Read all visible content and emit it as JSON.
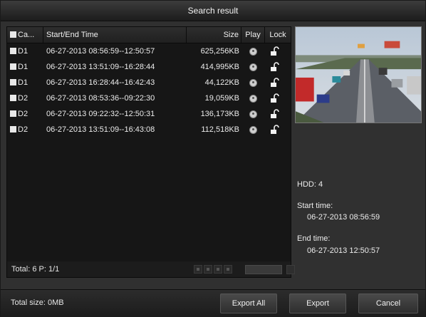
{
  "window": {
    "title": "Search result"
  },
  "table": {
    "headers": {
      "camera": "Ca...",
      "time": "Start/End Time",
      "size": "Size",
      "play": "Play",
      "lock": "Lock"
    },
    "rows": [
      {
        "camera": "D1",
        "time": "06-27-2013 08:56:59--12:50:57",
        "size": "625,256KB"
      },
      {
        "camera": "D1",
        "time": "06-27-2013 13:51:09--16:28:44",
        "size": "414,995KB"
      },
      {
        "camera": "D1",
        "time": "06-27-2013 16:28:44--16:42:43",
        "size": "44,122KB"
      },
      {
        "camera": "D2",
        "time": "06-27-2013 08:53:36--09:22:30",
        "size": "19,059KB"
      },
      {
        "camera": "D2",
        "time": "06-27-2013 09:22:32--12:50:31",
        "size": "136,173KB"
      },
      {
        "camera": "D2",
        "time": "06-27-2013 13:51:09--16:43:08",
        "size": "112,518KB"
      }
    ]
  },
  "status": {
    "total_label": "Total: 6  P: 1/1"
  },
  "details": {
    "hdd": "HDD: 4",
    "start_label": "Start time:",
    "start_value": "06-27-2013 08:56:59",
    "end_label": "End time:",
    "end_value": "06-27-2013 12:50:57"
  },
  "footer": {
    "total_size": "Total size: 0MB",
    "export_all": "Export All",
    "export": "Export",
    "cancel": "Cancel"
  },
  "icons": {
    "play": "play-icon",
    "lock": "unlock-icon"
  },
  "colors": {
    "background": "#303030",
    "list": "#161616",
    "text": "#ececec"
  }
}
